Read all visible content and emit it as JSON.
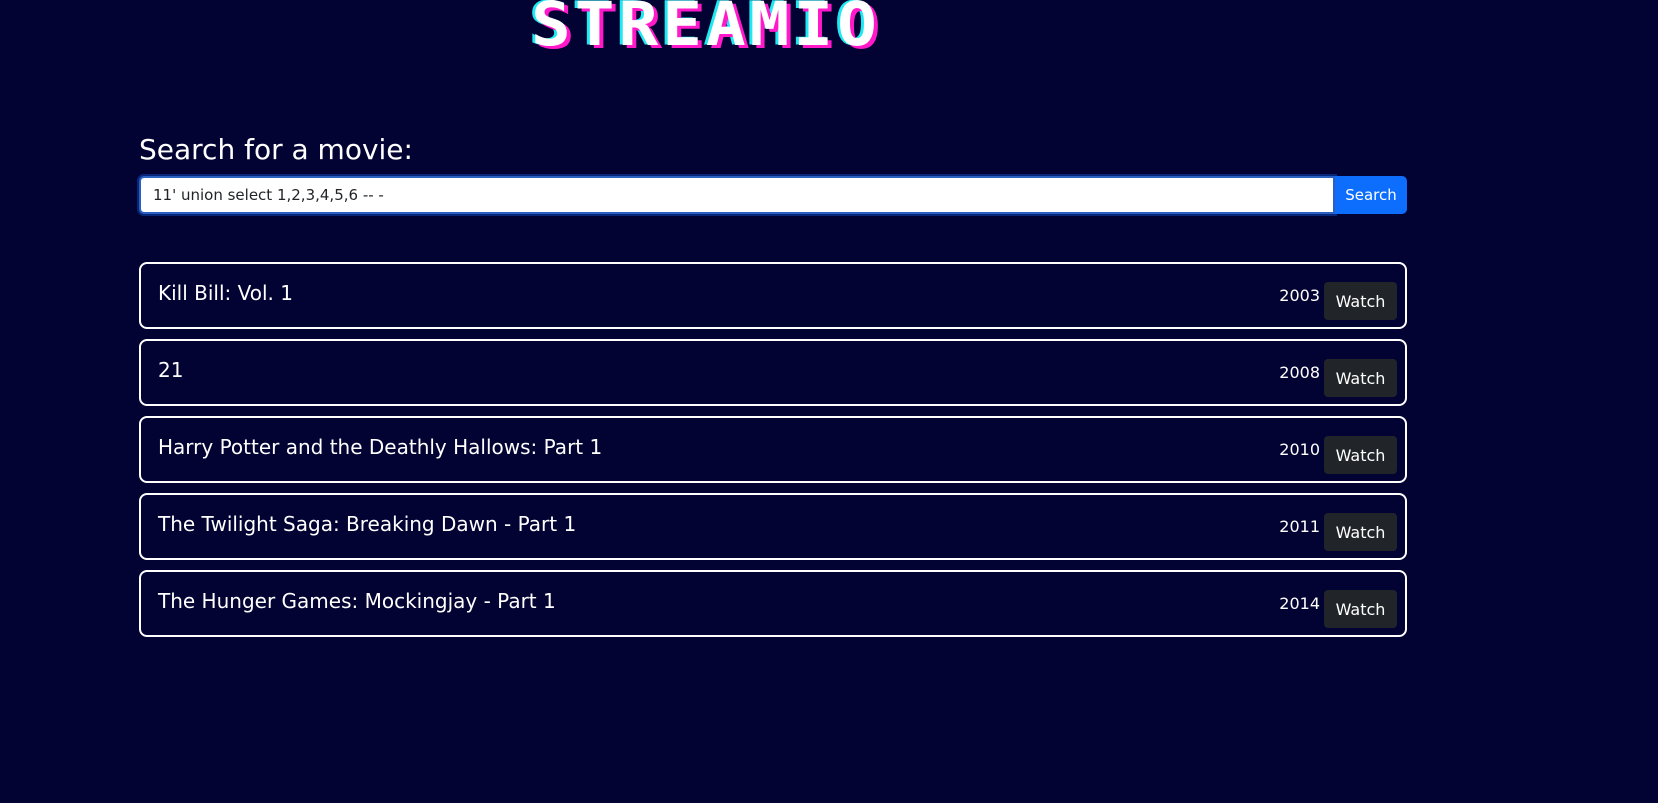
{
  "brand": {
    "logo_text": "STREAMIO",
    "colors": {
      "background": "#020233",
      "logo_pink": "#ff19c9",
      "logo_cyan": "#1ee8f2",
      "primary_button": "#0d6efd",
      "watch_button": "#212529"
    }
  },
  "search": {
    "heading": "Search for a movie:",
    "value": "11' union select 1,2,3,4,5,6 -- -",
    "button_label": "Search"
  },
  "results": [
    {
      "title": "Kill Bill: Vol. 1",
      "year": "2003",
      "action": "Watch"
    },
    {
      "title": "21",
      "year": "2008",
      "action": "Watch"
    },
    {
      "title": "Harry Potter and the Deathly Hallows: Part 1",
      "year": "2010",
      "action": "Watch"
    },
    {
      "title": "The Twilight Saga: Breaking Dawn - Part 1",
      "year": "2011",
      "action": "Watch"
    },
    {
      "title": "The Hunger Games: Mockingjay - Part 1",
      "year": "2014",
      "action": "Watch"
    }
  ]
}
